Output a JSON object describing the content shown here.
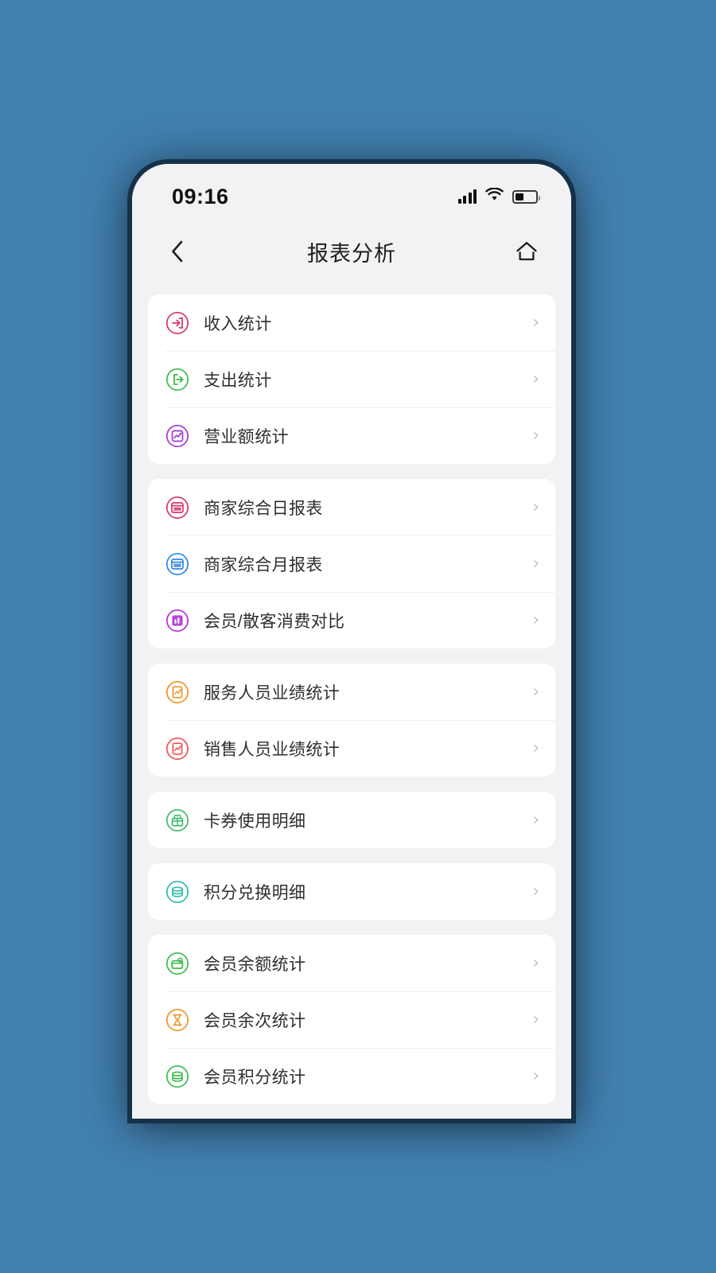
{
  "background_color": "#4280b0",
  "status_bar": {
    "time": "09:16",
    "signal_icon": "signal-bars-icon",
    "wifi_icon": "wifi-icon",
    "battery_icon": "battery-icon",
    "battery_level_percent": 42
  },
  "nav_bar": {
    "back_icon": "chevron-left-icon",
    "title": "报表分析",
    "home_icon": "home-icon"
  },
  "chevron": "›",
  "cards": [
    {
      "rows": [
        {
          "label": "收入统计",
          "icon": "arrow-into-door-icon",
          "color": "#d6356b"
        },
        {
          "label": "支出统计",
          "icon": "arrow-out-door-icon",
          "color": "#3dbb4a"
        },
        {
          "label": "营业额统计",
          "icon": "trend-chart-icon",
          "color": "#a833d6"
        }
      ]
    },
    {
      "rows": [
        {
          "label": "商家综合日报表",
          "icon": "day-report-icon",
          "color": "#d6356b"
        },
        {
          "label": "商家综合月报表",
          "icon": "month-report-icon",
          "color": "#2f86e0"
        },
        {
          "label": "会员/散客消费对比",
          "icon": "compare-chart-icon",
          "color": "#b32fd6"
        }
      ]
    },
    {
      "rows": [
        {
          "label": "服务人员业绩统计",
          "icon": "performance-doc-icon",
          "color": "#f0932b"
        },
        {
          "label": "销售人员业绩统计",
          "icon": "sales-doc-icon",
          "color": "#ef5350"
        }
      ]
    },
    {
      "rows": [
        {
          "label": "卡券使用明细",
          "icon": "gift-card-icon",
          "color": "#3dbb6a"
        }
      ]
    },
    {
      "rows": [
        {
          "label": "积分兑换明细",
          "icon": "coins-stack-icon",
          "color": "#2bbbad"
        }
      ]
    },
    {
      "rows": [
        {
          "label": "会员余额统计",
          "icon": "wallet-icon",
          "color": "#3dbb4a"
        },
        {
          "label": "会员余次统计",
          "icon": "hourglass-icon",
          "color": "#f0932b"
        },
        {
          "label": "会员积分统计",
          "icon": "points-icon",
          "color": "#3dbb4a"
        }
      ]
    }
  ]
}
